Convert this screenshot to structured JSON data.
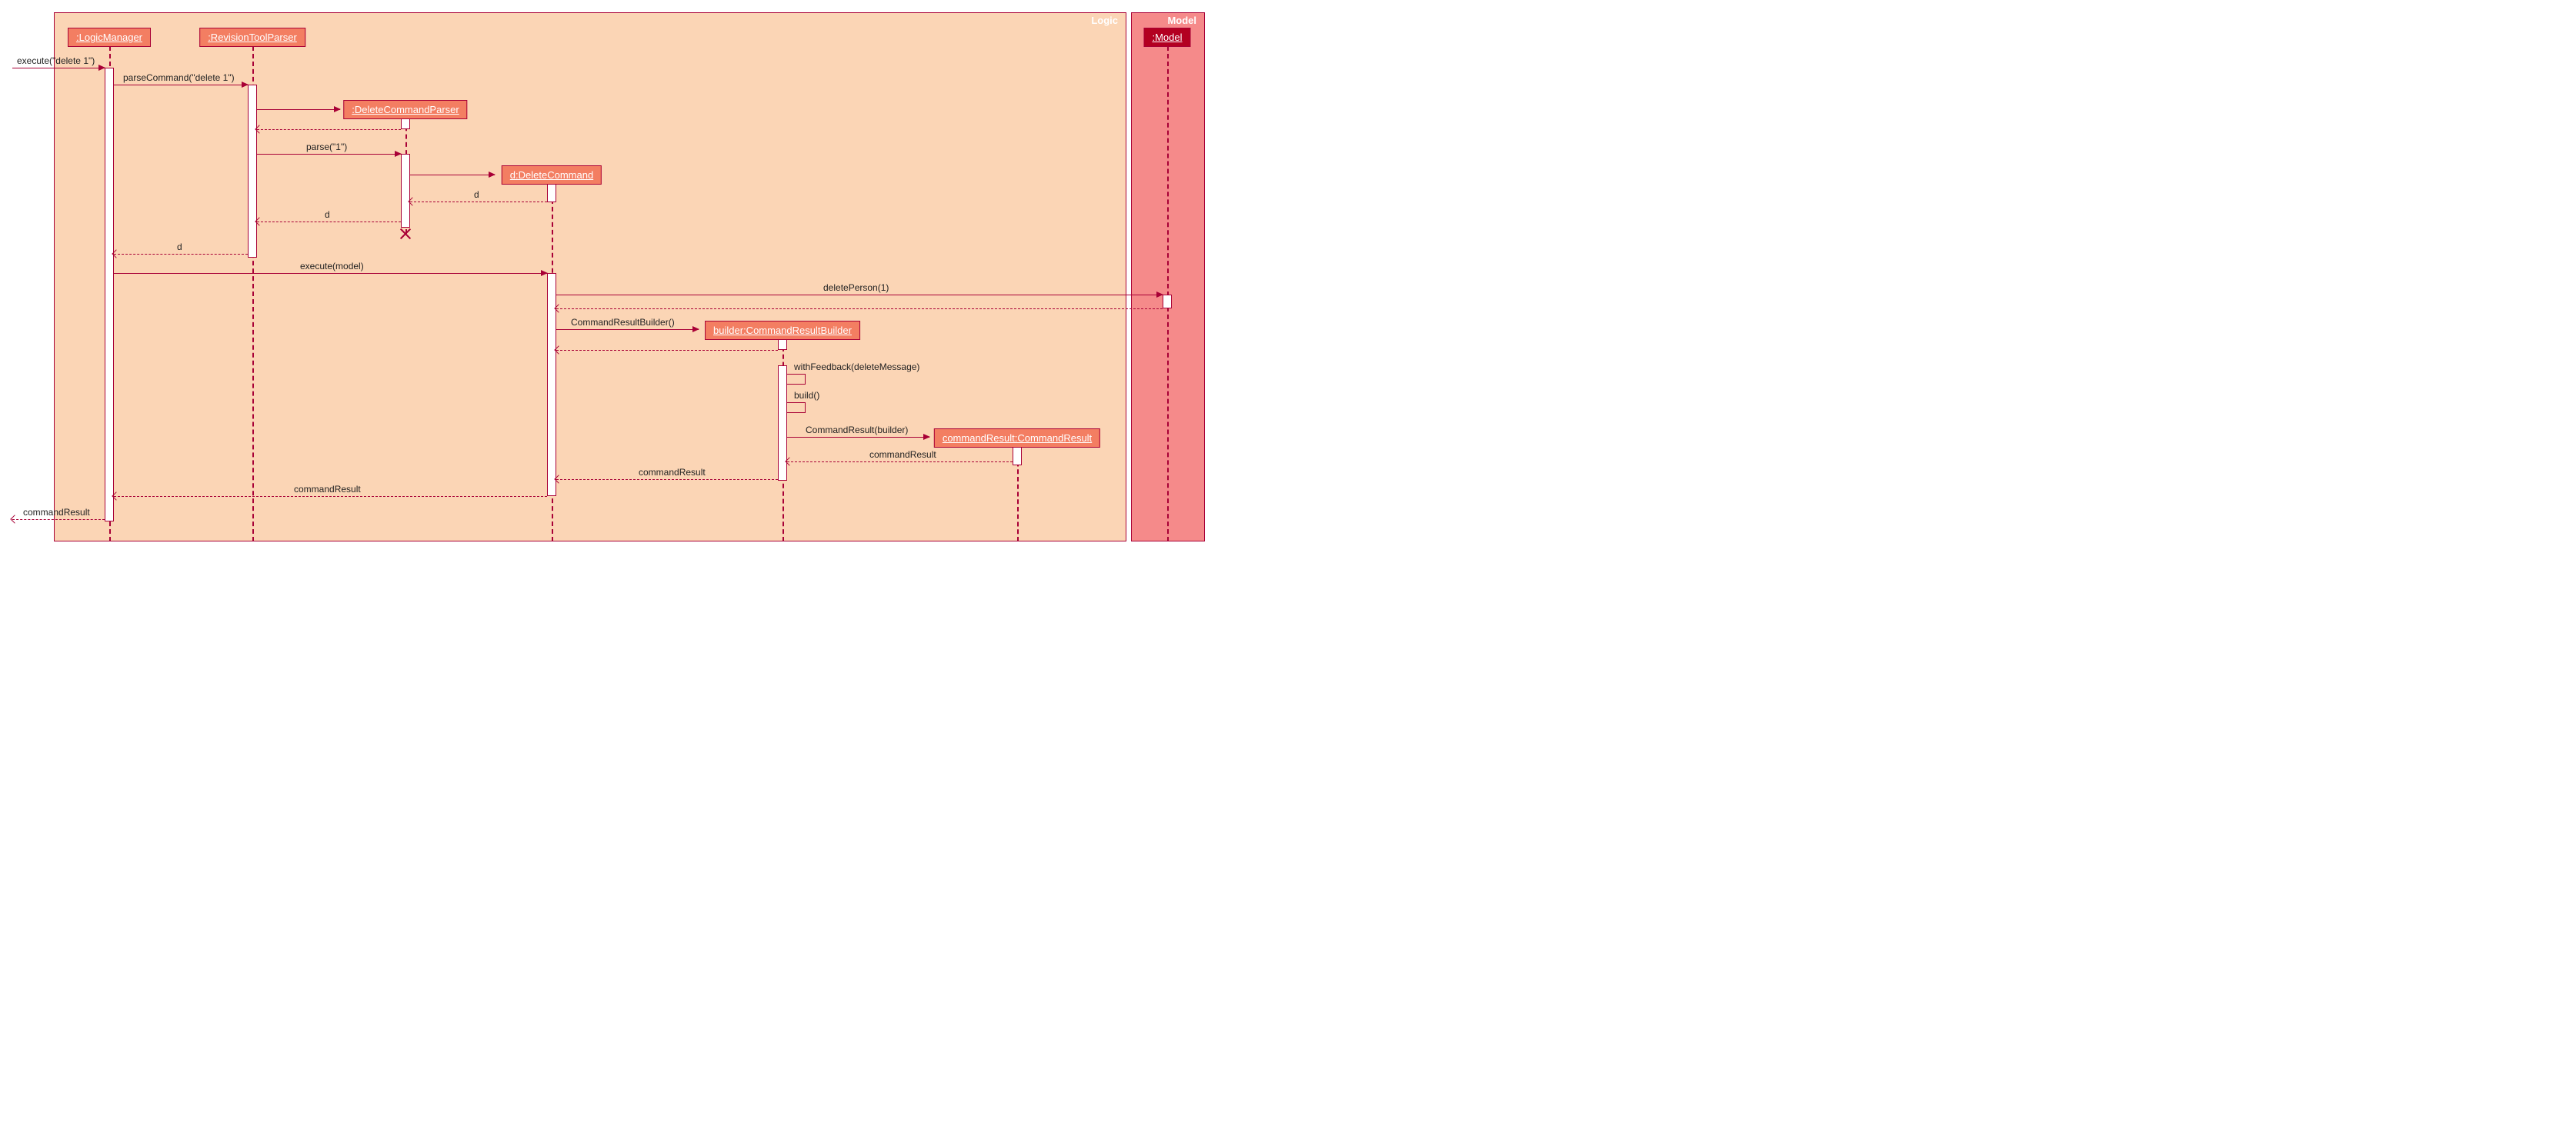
{
  "frames": {
    "logic": {
      "label": "Logic"
    },
    "model": {
      "label": "Model"
    }
  },
  "participants": {
    "logicManager": ":LogicManager",
    "revisionToolParser": ":RevisionToolParser",
    "deleteCommandParser": ":DeleteCommandParser",
    "deleteCommand": "d:DeleteCommand",
    "commandResultBuilder": "builder:CommandResultBuilder",
    "commandResult": "commandResult:CommandResult",
    "model": ":Model"
  },
  "messages": {
    "m1": "execute(\"delete 1\")",
    "m2": "parseCommand(\"delete 1\")",
    "m3_return_dcp": "",
    "m4": "parse(\"1\")",
    "m5_return_d1": "d",
    "m6_return_d2": "d",
    "m7_return_d3": "d",
    "m8": "execute(model)",
    "m9": "deletePerson(1)",
    "m10": "CommandResultBuilder()",
    "m11": "withFeedback(deleteMessage)",
    "m12": "build()",
    "m13": "CommandResult(builder)",
    "m14": "commandResult",
    "m15": "commandResult",
    "m16": "commandResult",
    "m17": "commandResult"
  },
  "layout": {
    "x": {
      "external": 6,
      "logicManager": 132,
      "revisionToolParser": 318,
      "deleteCommandParser": 517,
      "deleteCommand": 707,
      "commandResultBuilder": 1007,
      "commandResult": 1312,
      "model": 1507
    }
  }
}
